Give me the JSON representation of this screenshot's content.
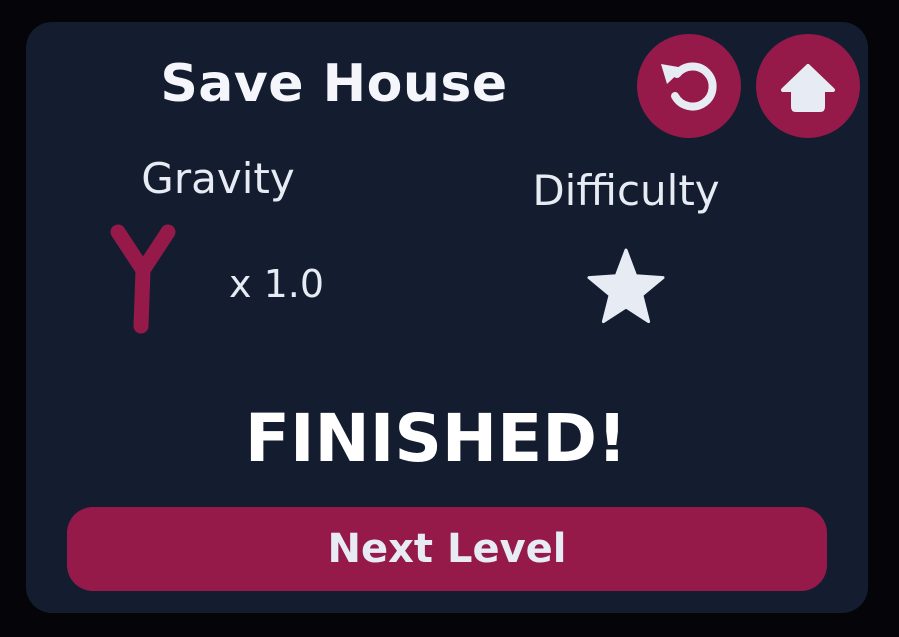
{
  "level": {
    "title": "Save House"
  },
  "buttons": {
    "restart_icon": "restart-icon",
    "home_icon": "home-icon",
    "next_label": "Next Level"
  },
  "gravity": {
    "label": "Gravity",
    "value": "x 1.0",
    "icon": "gravity-arrow-icon"
  },
  "difficulty": {
    "label": "Difficulty",
    "stars": 1,
    "icon": "star-icon"
  },
  "status": {
    "text": "FINISHED!"
  },
  "colors": {
    "background": "#050509",
    "panel": "#141d2f",
    "accent": "#951a49",
    "text": "#e6ebf4"
  }
}
